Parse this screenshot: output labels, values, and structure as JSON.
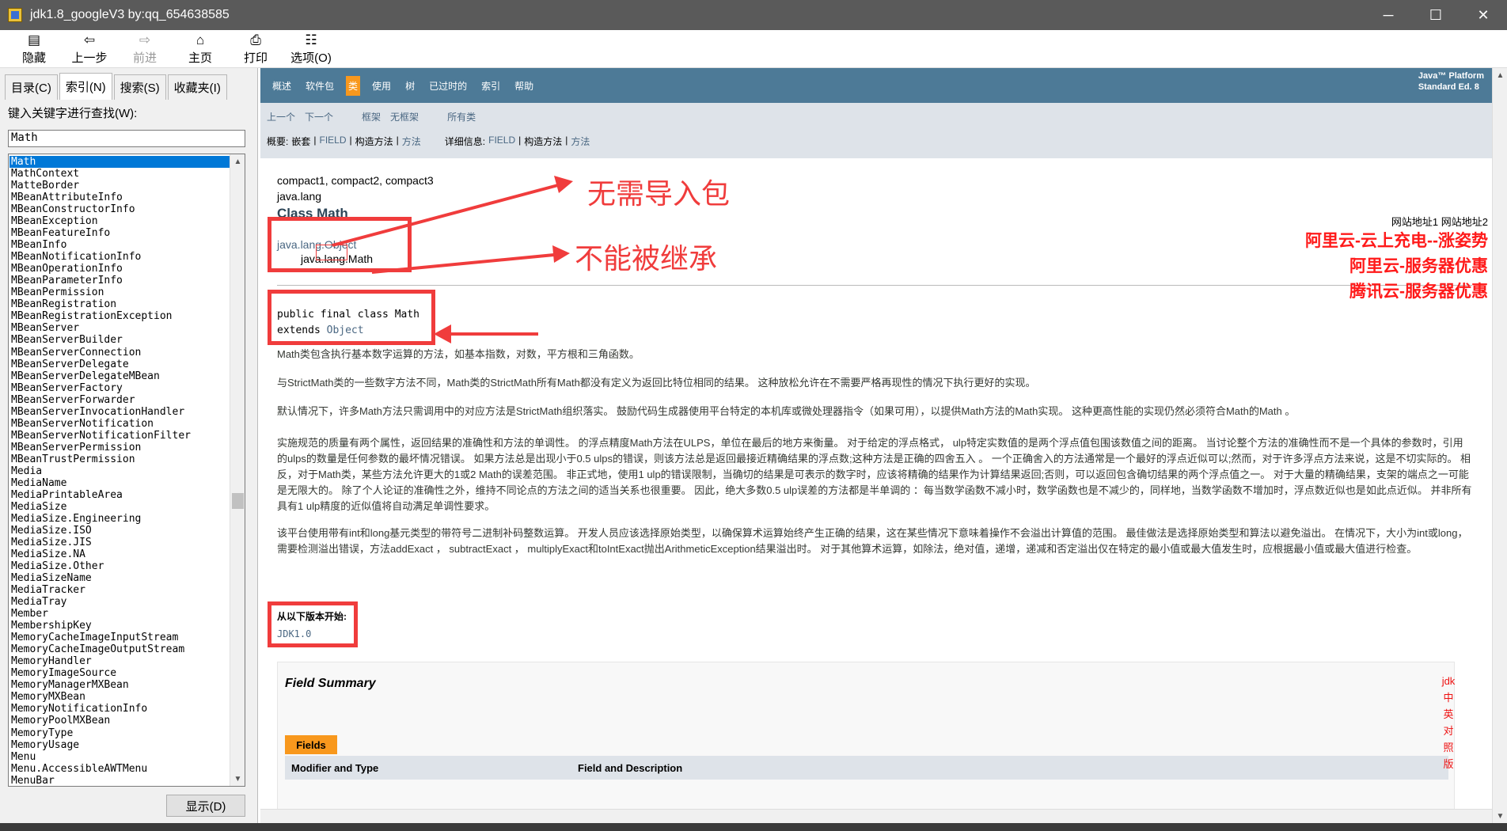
{
  "window": {
    "title": "jdk1.8_googleV3 by:qq_654638585",
    "controls": {
      "minimize": "─",
      "maximize": "☐",
      "close": "✕"
    }
  },
  "toolbar": {
    "hide": "隐藏",
    "back": "上一步",
    "forward": "前进",
    "home": "主页",
    "print": "打印",
    "options": "选项(O)"
  },
  "leftpane": {
    "tabs": [
      "目录(C)",
      "索引(N)",
      "搜索(S)",
      "收藏夹(I)"
    ],
    "search_label": "键入关键字进行查找(W):",
    "search_value": "Math",
    "items": [
      "Math",
      "MathContext",
      "MatteBorder",
      "MBeanAttributeInfo",
      "MBeanConstructorInfo",
      "MBeanException",
      "MBeanFeatureInfo",
      "MBeanInfo",
      "MBeanNotificationInfo",
      "MBeanOperationInfo",
      "MBeanParameterInfo",
      "MBeanPermission",
      "MBeanRegistration",
      "MBeanRegistrationException",
      "MBeanServer",
      "MBeanServerBuilder",
      "MBeanServerConnection",
      "MBeanServerDelegate",
      "MBeanServerDelegateMBean",
      "MBeanServerFactory",
      "MBeanServerForwarder",
      "MBeanServerInvocationHandler",
      "MBeanServerNotification",
      "MBeanServerNotificationFilter",
      "MBeanServerPermission",
      "MBeanTrustPermission",
      "Media",
      "MediaName",
      "MediaPrintableArea",
      "MediaSize",
      "MediaSize.Engineering",
      "MediaSize.ISO",
      "MediaSize.JIS",
      "MediaSize.NA",
      "MediaSize.Other",
      "MediaSizeName",
      "MediaTracker",
      "MediaTray",
      "Member",
      "MembershipKey",
      "MemoryCacheImageInputStream",
      "MemoryCacheImageOutputStream",
      "MemoryHandler",
      "MemoryImageSource",
      "MemoryManagerMXBean",
      "MemoryMXBean",
      "MemoryNotificationInfo",
      "MemoryPoolMXBean",
      "MemoryType",
      "MemoryUsage",
      "Menu",
      "Menu.AccessibleAWTMenu",
      "MenuBar"
    ],
    "display_button": "显示(D)"
  },
  "nav1": {
    "items": [
      "概述",
      "软件包",
      "类",
      "使用",
      "树",
      "已过时的",
      "索引",
      "帮助"
    ],
    "active_index": 2,
    "about_line1": "Java™ Platform",
    "about_line2": "Standard Ed. 8"
  },
  "nav2": {
    "prev": "上一个",
    "next": "下一个",
    "frames": "框架",
    "noframes": "无框架",
    "allclasses": "所有类",
    "summary_label": "概要:",
    "summary_nested": "嵌套",
    "summary_field": "FIELD",
    "summary_constr": "构造方法",
    "summary_method": "方法",
    "detail_label": "详细信息:",
    "detail_field": "FIELD",
    "detail_constr": "构造方法",
    "detail_method": "方法",
    "sep": "|"
  },
  "doc": {
    "profiles": "compact1, compact2, compact3",
    "package": "java.lang",
    "class_title": "Class Math",
    "inherit_parent": "java.lang.Object",
    "inherit_child": "java.lang.Math",
    "sig_line1": "public final class Math",
    "sig_line2_kw": "extends",
    "sig_line2_link": "Object",
    "paragraphs": [
      "Math类包含执行基本数字运算的方法，如基本指数，对数，平方根和三角函数。",
      "与StrictMath类的一些数字方法不同，Math类的StrictMath所有Math都没有定义为返回比特位相同的结果。 这种放松允许在不需要严格再现性的情况下执行更好的实现。",
      "默认情况下，许多Math方法只需调用中的对应方法是StrictMath组织落实。 鼓励代码生成器使用平台特定的本机库或微处理器指令（如果可用），以提供Math方法的Math实现。 这种更高性能的实现仍然必须符合Math的Math 。",
      "实施规范的质量有两个属性，返回结果的准确性和方法的单调性。 的浮点精度Math方法在ULPS，单位在最后的地方来衡量。 对于给定的浮点格式， ulp特定实数值的是两个浮点值包围该数值之间的距离。 当讨论整个方法的准确性而不是一个具体的参数时，引用的ulps的数量是任何参数的最坏情况错误。 如果方法总是出现小于0.5 ulps的错误，则该方法总是返回最接近精确结果的浮点数;这种方法是正确的四舍五入 。 一个正确舍入的方法通常是一个最好的浮点近似可以;然而，对于许多浮点方法来说，这是不切实际的。 相反，对于Math类，某些方法允许更大的1或2 Math的误差范围。 非正式地，使用1 ulp的错误限制，当确切的结果是可表示的数字时，应该将精确的结果作为计算结果返回;否则，可以返回包含确切结果的两个浮点值之一。 对于大量的精确结果，支架的端点之一可能是无限大的。 除了个人论证的准确性之外，维持不同论点的方法之间的适当关系也很重要。 因此，绝大多数0.5 ulp误差的方法都是半单调的 ：每当数学函数不减小时，数学函数也是不减少的，同样地，当数学函数不增加时，浮点数近似也是如此点近似。 并非所有具有1 ulp精度的近似值将自动满足单调性要求。",
      "该平台使用带有int和long基元类型的带符号二进制补码整数运算。 开发人员应该选择原始类型，以确保算术运算始终产生正确的结果，这在某些情况下意味着操作不会溢出计算值的范围。 最佳做法是选择原始类型和算法以避免溢出。 在情况下，大小为int或long，需要检测溢出错误，方法addExact ， subtractExact ， multiplyExact和toIntExact抛出ArithmeticException结果溢出时。 对于其他算术运算，如除法，绝对值，递增，递减和否定溢出仅在特定的最小值或最大值发生时，应根据最小值或最大值进行检查。"
    ],
    "since_label": "从以下版本开始:",
    "since_value": "JDK1.0",
    "field_summary_title": "Field Summary",
    "fields_tab": "Fields",
    "col1": "Modifier and Type",
    "col2": "Field and Description"
  },
  "ads": {
    "small": "网站地址1 网站地址2",
    "line1": "阿里云-云上充电--涨姿势",
    "line2": "阿里云-服务器优惠",
    "line3": "腾讯云-服务器优惠",
    "vertical": [
      "jdk",
      "中",
      "英",
      "对",
      "照",
      "版"
    ]
  },
  "annotations": {
    "no_import": "无需导入包",
    "not_inherit": "不能被继承",
    "color": "#f03c3c"
  }
}
